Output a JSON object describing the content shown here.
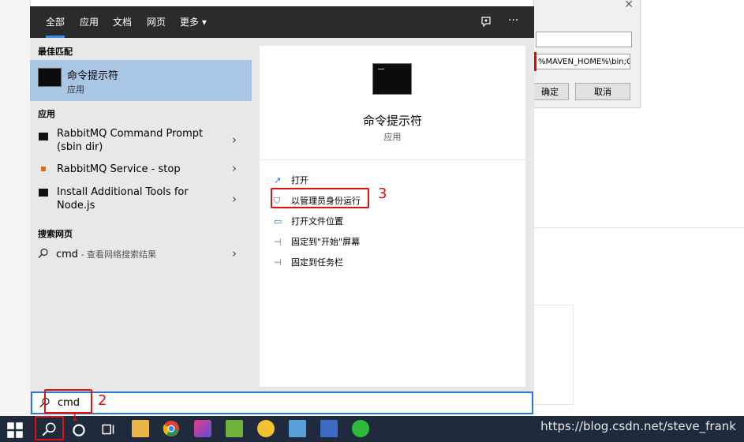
{
  "tabs": [
    "全部",
    "应用",
    "文档",
    "网页",
    "更多"
  ],
  "tab_more_caret": "▾",
  "top_icons": {
    "feedback": "feedback-icon",
    "more": "···"
  },
  "left": {
    "best_match_header": "最佳匹配",
    "best": {
      "title": "命令提示符",
      "subtitle": "应用"
    },
    "apps_header": "应用",
    "apps": [
      {
        "line1": "RabbitMQ Command Prompt",
        "line2": "(sbin dir)"
      },
      {
        "line1": "RabbitMQ Service - stop",
        "line2": ""
      },
      {
        "line1": "Install Additional Tools for",
        "line2": "Node.js"
      }
    ],
    "web_header": "搜索网页",
    "web": {
      "term": "cmd",
      "hint": " - 查看网络搜索结果"
    }
  },
  "right": {
    "title": "命令提示符",
    "subtitle": "应用",
    "actions": [
      "打开",
      "以管理员身份运行",
      "打开文件位置",
      "固定到\"开始\"屏幕",
      "固定到任务栏"
    ]
  },
  "search": {
    "value": "cmd"
  },
  "annotations": [
    "1",
    "2",
    "3"
  ],
  "bg_dialog": {
    "path_text": "%MAVEN_HOME%\\bin;C:\\",
    "ok": "确定",
    "cancel": "取消",
    "close": "✕"
  },
  "watermark": "https://blog.csdn.net/steve_frank",
  "colors": {
    "accent": "#2b78d4",
    "highlight": "#a9c6e5",
    "annotation": "#e01010"
  }
}
